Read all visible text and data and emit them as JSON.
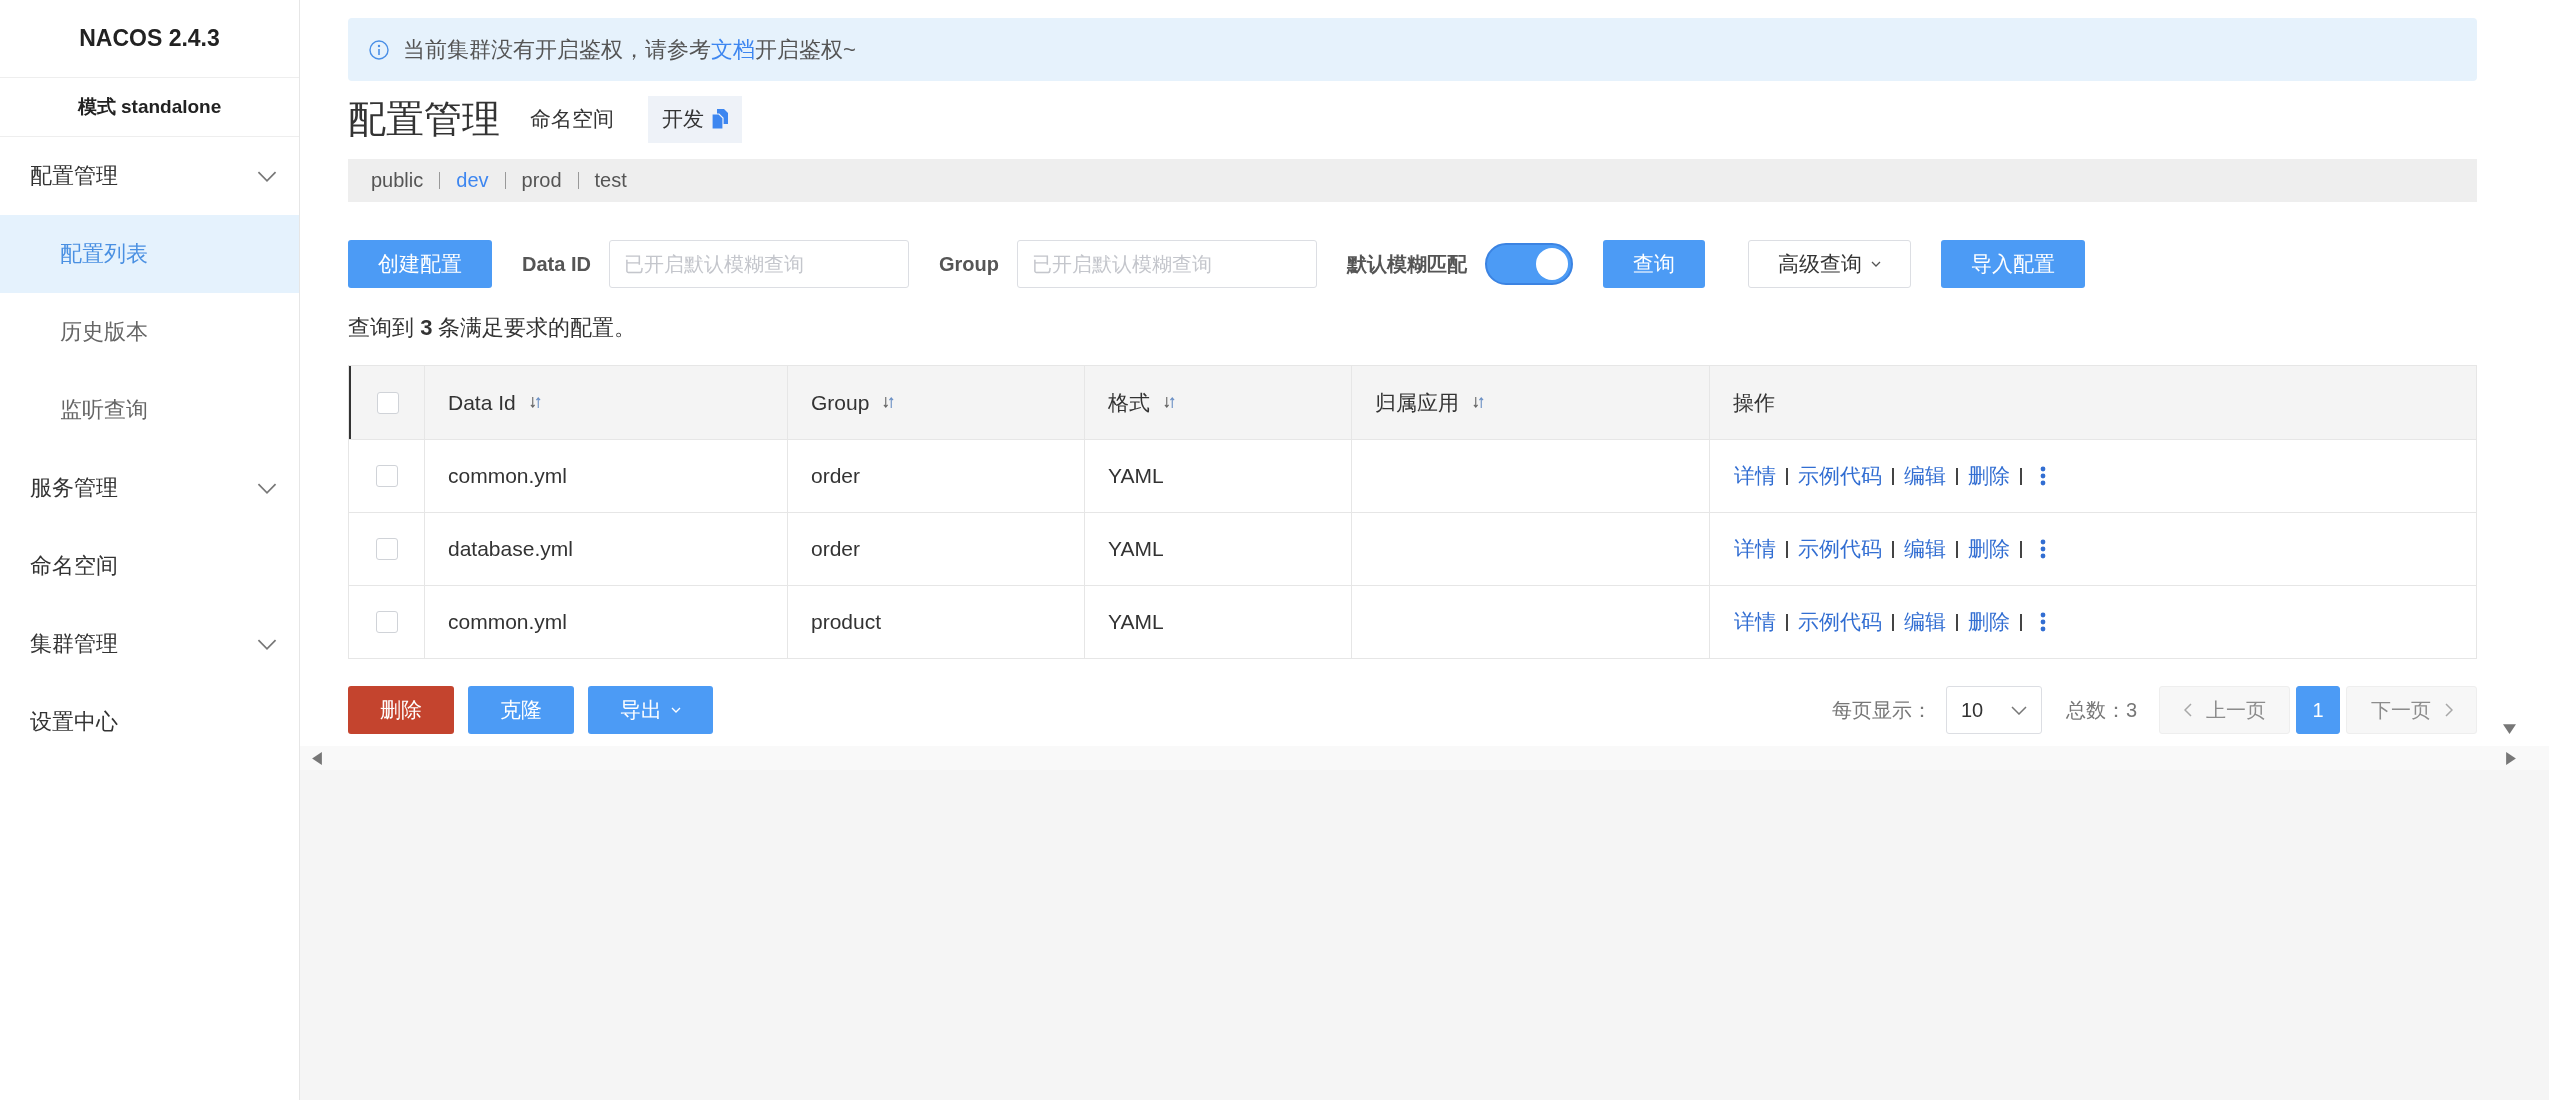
{
  "sidebar": {
    "title": "NACOS 2.4.3",
    "mode": "模式 standalone",
    "items": [
      {
        "label": "配置管理",
        "kind": "group",
        "selected": false,
        "children": [
          {
            "label": "配置列表",
            "selected": true
          },
          {
            "label": "历史版本",
            "selected": false
          },
          {
            "label": "监听查询",
            "selected": false
          }
        ]
      },
      {
        "label": "服务管理",
        "kind": "group",
        "selected": false
      },
      {
        "label": "命名空间",
        "kind": "link",
        "selected": false
      },
      {
        "label": "集群管理",
        "kind": "group",
        "selected": false
      },
      {
        "label": "设置中心",
        "kind": "link",
        "selected": false
      }
    ]
  },
  "notice": {
    "text_before": "当前集群没有开启鉴权，请参考",
    "link": "文档",
    "text_after": "开启鉴权~"
  },
  "header": {
    "title": "配置管理",
    "namespace_label": "命名空间",
    "namespace": "开发"
  },
  "namespaces": [
    {
      "label": "public",
      "selected": false
    },
    {
      "label": "dev",
      "selected": true
    },
    {
      "label": "prod",
      "selected": false
    },
    {
      "label": "test",
      "selected": false
    }
  ],
  "toolbar": {
    "create_button": "创建配置",
    "fields": [
      {
        "label": "Data ID",
        "placeholder": "已开启默认模糊查询"
      },
      {
        "label": "Group",
        "placeholder": "已开启默认模糊查询"
      }
    ],
    "fuzzy_match": {
      "label": "默认模糊匹配",
      "on": true
    },
    "buttons": [
      {
        "label": "查询",
        "kind": "primary",
        "dropdown": false
      },
      {
        "label": "高级查询",
        "kind": "normal",
        "dropdown": true
      },
      {
        "label": "导入配置",
        "kind": "primary",
        "dropdown": false
      }
    ]
  },
  "summary": "查询到 **3** 条满足要求的配置。",
  "table": {
    "select_all": {
      "checked": false
    },
    "columns": [
      {
        "label": "Data Id",
        "kind": "text",
        "sortable": true
      },
      {
        "label": "Group",
        "kind": "text",
        "sortable": true
      },
      {
        "label": "格式",
        "kind": "text",
        "sortable": true
      },
      {
        "label": "归属应用",
        "kind": "text",
        "sortable": true
      },
      {
        "label": "操作",
        "kind": "actions",
        "sortable": false
      }
    ],
    "rows": [
      {
        "checked": false,
        "cells": [
          "common.yml",
          "order",
          "YAML"
        ],
        "actions": [
          "详情",
          "示例代码",
          "编辑",
          "删除"
        ]
      },
      {
        "checked": false,
        "cells": [
          "database.yml",
          "order",
          "YAML"
        ],
        "actions": [
          "详情",
          "示例代码",
          "编辑",
          "删除"
        ]
      },
      {
        "checked": false,
        "cells": [
          "common.yml",
          "product",
          "YAML"
        ],
        "actions": [
          "详情",
          "示例代码",
          "编辑",
          "删除"
        ]
      }
    ]
  },
  "footer": {
    "buttons": [
      {
        "label": "删除",
        "kind": "danger",
        "dropdown": false
      },
      {
        "label": "克隆",
        "kind": "primary",
        "dropdown": false
      },
      {
        "label": "导出",
        "kind": "primary",
        "dropdown": true
      }
    ],
    "pagination": {
      "page_size_label": "每页显示：",
      "page_size": "10",
      "total": "总数：3",
      "prev": {
        "label": "上一页",
        "disabled": true
      },
      "pages": [
        {
          "label": "1",
          "selected": true
        }
      ],
      "next": {
        "label": "下一页",
        "disabled": true
      }
    }
  }
}
